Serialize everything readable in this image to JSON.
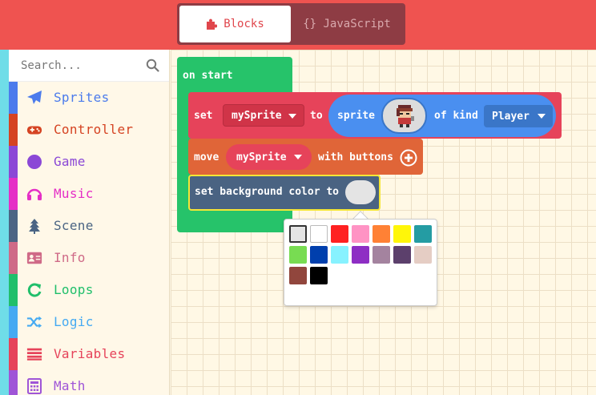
{
  "mode_toggle": {
    "blocks_label": "Blocks",
    "js_label": "{} JavaScript"
  },
  "search": {
    "placeholder": "Search..."
  },
  "categories": [
    {
      "label": "Sprites",
      "color": "#4b7bec",
      "icon": "paper-plane-icon"
    },
    {
      "label": "Controller",
      "color": "#d54322",
      "icon": "gamepad-icon"
    },
    {
      "label": "Game",
      "color": "#8b48d6",
      "icon": "circle-icon"
    },
    {
      "label": "Music",
      "color": "#e52fc6",
      "icon": "headphones-icon"
    },
    {
      "label": "Scene",
      "color": "#4b6584",
      "icon": "tree-icon"
    },
    {
      "label": "Info",
      "color": "#cf6a87",
      "icon": "id-card-icon"
    },
    {
      "label": "Loops",
      "color": "#20bf6b",
      "icon": "refresh-icon"
    },
    {
      "label": "Logic",
      "color": "#45aaf2",
      "icon": "shuffle-icon"
    },
    {
      "label": "Variables",
      "color": "#e6435a",
      "icon": "list-icon"
    },
    {
      "label": "Math",
      "color": "#9f55d7",
      "icon": "calculator-icon"
    }
  ],
  "blocks": {
    "on_start": "on start",
    "set": "set",
    "set_var": "mySprite",
    "to": "to",
    "sprite": "sprite",
    "of_kind": "of kind",
    "kind": "Player",
    "move": "move",
    "move_var": "mySprite",
    "with_buttons": "with buttons",
    "set_bg": "set background color to"
  },
  "palette": {
    "selected": 0,
    "colors": [
      "#e4e4e4",
      "#ffffff",
      "#ff2121",
      "#ff93c4",
      "#ff8135",
      "#fff609",
      "#249ca3",
      "#78dc52",
      "#003fad",
      "#87f2ff",
      "#8e2ec4",
      "#a4839f",
      "#5c406c",
      "#e5cdc4",
      "#91463d",
      "#000000"
    ]
  }
}
